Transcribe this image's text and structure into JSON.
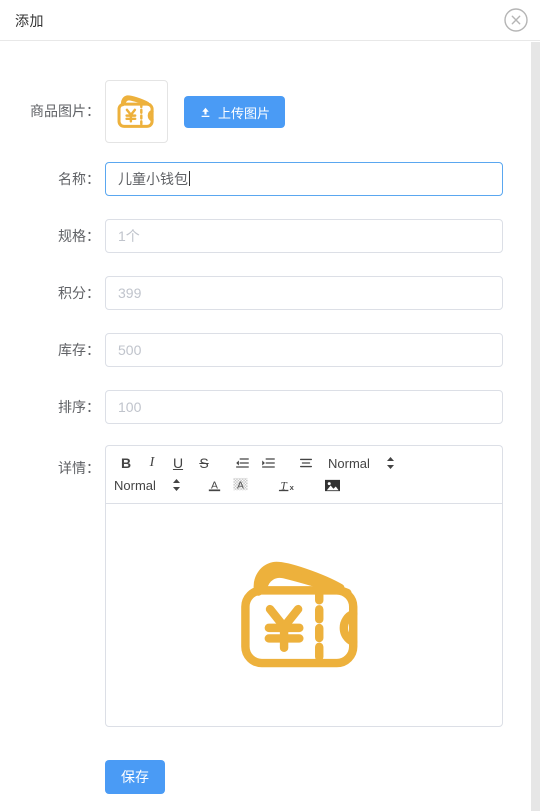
{
  "dialog": {
    "title": "添加",
    "close_icon": "close-circle-icon"
  },
  "form": {
    "image_row": {
      "label": "商品图片：",
      "thumbnail_icon": "wallet-yen-icon",
      "upload_button_label": "上传图片",
      "upload_button_icon": "upload-icon"
    },
    "fields": [
      {
        "label": "名称：",
        "value": "儿童小钱包",
        "focused": true
      },
      {
        "label": "规格：",
        "value": "1个",
        "focused": false
      },
      {
        "label": "积分：",
        "value": "399",
        "focused": false
      },
      {
        "label": "库存：",
        "value": "500",
        "focused": false
      },
      {
        "label": "排序：",
        "value": "100",
        "focused": false
      }
    ],
    "detail": {
      "label": "详情：",
      "toolbar": {
        "row1": [
          {
            "name": "bold-icon",
            "glyph": "B"
          },
          {
            "name": "italic-icon",
            "glyph": "I"
          },
          {
            "name": "underline-icon",
            "glyph": "U"
          },
          {
            "name": "strikethrough-icon",
            "glyph": "S"
          },
          {
            "name": "outdent-icon",
            "glyph": ""
          },
          {
            "name": "indent-icon",
            "glyph": ""
          },
          {
            "name": "align-icon",
            "glyph": ""
          }
        ],
        "row1_picker": {
          "name": "header-picker",
          "value": "Normal"
        },
        "row2_picker": {
          "name": "size-picker",
          "value": "Normal"
        },
        "row2": [
          {
            "name": "font-color-icon",
            "glyph": "A"
          },
          {
            "name": "background-color-icon",
            "glyph": "A"
          },
          {
            "name": "clear-format-icon",
            "glyph": "Tx"
          },
          {
            "name": "insert-image-icon",
            "glyph": ""
          }
        ]
      },
      "content_image_icon": "wallet-yen-icon"
    },
    "save_button_label": "保存"
  },
  "colors": {
    "accent_blue": "#4a9bf5",
    "focus_border": "#5aa7f0",
    "icon_gold": "#edb13c",
    "border_grey": "#dcdfe6",
    "label_grey": "#606266",
    "placeholder_grey": "#c0c4cc"
  }
}
